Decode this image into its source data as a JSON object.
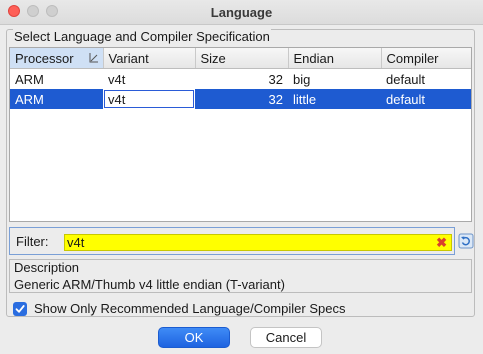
{
  "window": {
    "title": "Language"
  },
  "group": {
    "title": "Select Language and Compiler Specification"
  },
  "table": {
    "columns": [
      "Processor",
      "Variant",
      "Size",
      "Endian",
      "Compiler"
    ],
    "rows": [
      {
        "processor": "ARM",
        "variant": "v4t",
        "size": "32",
        "endian": "big",
        "compiler": "default"
      },
      {
        "processor": "ARM",
        "variant": "v4t",
        "size": "32",
        "endian": "little",
        "compiler": "default"
      }
    ],
    "selected_row": 1
  },
  "filter": {
    "label": "Filter:",
    "value": "v4t"
  },
  "description": {
    "title": "Description",
    "text": "Generic ARM/Thumb v4 little endian (T-variant)"
  },
  "checkbox": {
    "label": "Show Only Recommended Language/Compiler Specs",
    "checked": true
  },
  "buttons": {
    "ok": "OK",
    "cancel": "Cancel"
  },
  "colors": {
    "selection": "#1e5bd1",
    "filter_bg": "#ffff00",
    "accent": "#2a6de0"
  }
}
